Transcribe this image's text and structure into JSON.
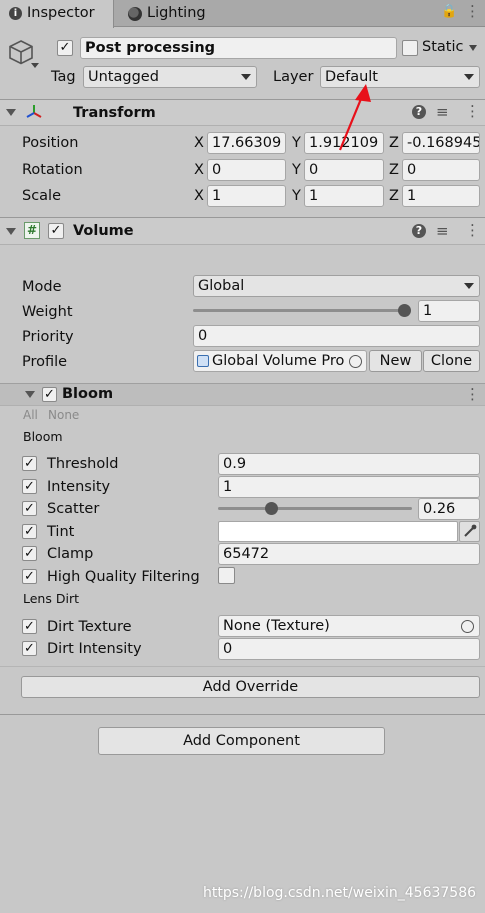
{
  "tabs": [
    {
      "label": "Inspector",
      "icon": "info-icon"
    },
    {
      "label": "Lighting",
      "icon": "lighting-icon"
    }
  ],
  "gameobject": {
    "active": true,
    "name": "Post processing",
    "static_label": "Static",
    "static_checked": false,
    "tag_label": "Tag",
    "tag_value": "Untagged",
    "layer_label": "Layer",
    "layer_value": "Default"
  },
  "transform": {
    "title": "Transform",
    "rows": [
      {
        "label": "Position",
        "x": "17.66309",
        "y": "1.912109",
        "z": "-0.168945"
      },
      {
        "label": "Rotation",
        "x": "0",
        "y": "0",
        "z": "0"
      },
      {
        "label": "Scale",
        "x": "1",
        "y": "1",
        "z": "1"
      }
    ],
    "axis": {
      "x": "X",
      "y": "Y",
      "z": "Z"
    }
  },
  "volume": {
    "title": "Volume",
    "enabled": true,
    "mode_label": "Mode",
    "mode_value": "Global",
    "weight_label": "Weight",
    "weight_value": "1",
    "weight_fraction": 1.0,
    "priority_label": "Priority",
    "priority_value": "0",
    "profile_label": "Profile",
    "profile_value": "Global Volume Pro",
    "new_label": "New",
    "clone_label": "Clone"
  },
  "bloom": {
    "title": "Bloom",
    "enabled": true,
    "all_label": "All",
    "none_label": "None",
    "section_bloom": "Bloom",
    "threshold_label": "Threshold",
    "threshold_value": "0.9",
    "intensity_label": "Intensity",
    "intensity_value": "1",
    "scatter_label": "Scatter",
    "scatter_value": "0.26",
    "scatter_fraction": 0.26,
    "tint_label": "Tint",
    "clamp_label": "Clamp",
    "clamp_value": "65472",
    "hq_label": "High Quality Filtering",
    "hq_checked": false,
    "section_lens": "Lens Dirt",
    "dirt_texture_label": "Dirt Texture",
    "dirt_texture_value": "None (Texture)",
    "dirt_intensity_label": "Dirt Intensity",
    "dirt_intensity_value": "0"
  },
  "add_override_label": "Add Override",
  "add_component_label": "Add Component",
  "watermark": "https://blog.csdn.net/weixin_45637586",
  "check_glyph": "✓",
  "colors": {
    "arrow": "#e8101a",
    "panel": "#c8c8c8",
    "header": "#cbcbcb",
    "field": "#f0f0f0"
  }
}
